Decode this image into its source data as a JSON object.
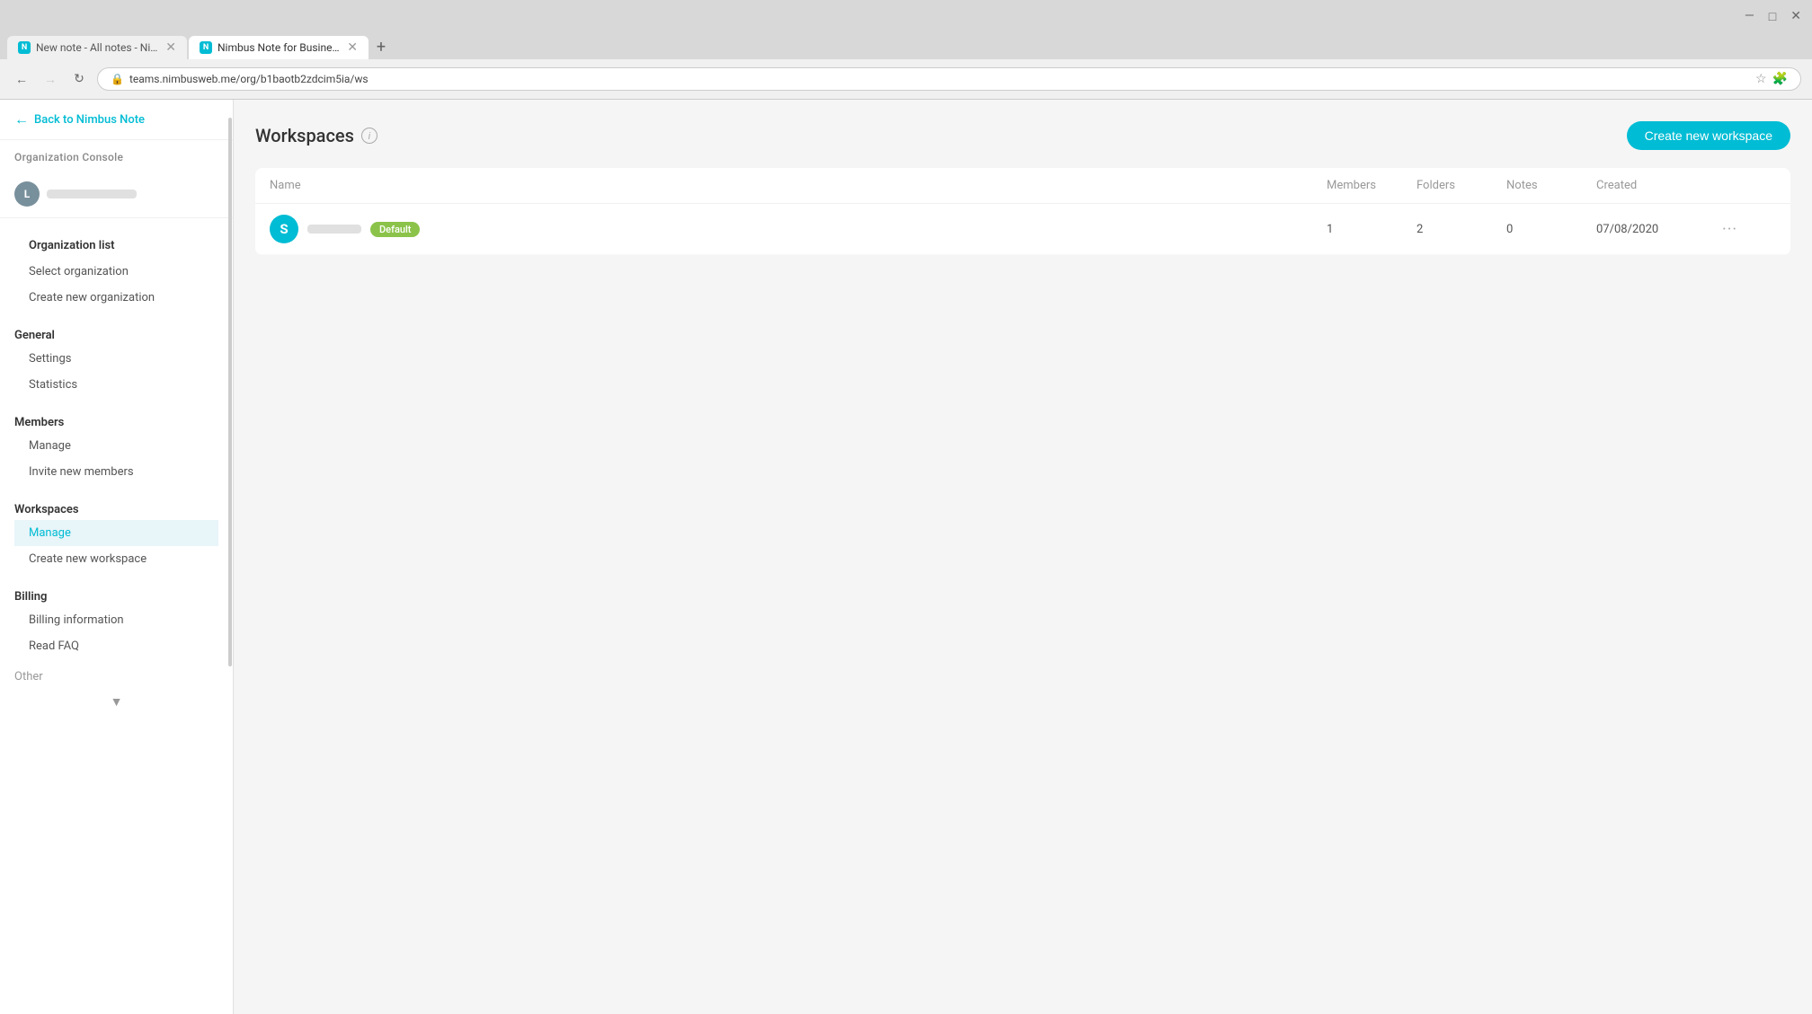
{
  "browser": {
    "tabs": [
      {
        "id": "tab1",
        "icon_letter": "N",
        "title": "New note - All notes - Nimbus ...",
        "active": false
      },
      {
        "id": "tab2",
        "icon_letter": "N",
        "title": "Nimbus Note for Business - Org...",
        "active": true
      }
    ],
    "new_tab_label": "+",
    "url": "teams.nimbusweb.me/org/b1baotb2zdcim5ia/ws",
    "nav": {
      "back_disabled": false,
      "forward_disabled": true
    }
  },
  "window_controls": {
    "minimize": "—",
    "maximize": "□",
    "close": "✕"
  },
  "sidebar": {
    "back_label": "Back to Nimbus Note",
    "org_console_label": "Organization Console",
    "user_avatar_letter": "L",
    "sections": [
      {
        "id": "org",
        "title": "",
        "items": [
          {
            "id": "org-list",
            "label": "Organization list",
            "is_section_title": true
          },
          {
            "id": "select-org",
            "label": "Select organization",
            "active": false
          },
          {
            "id": "create-org",
            "label": "Create new organization",
            "active": false
          }
        ]
      },
      {
        "id": "general",
        "title": "General",
        "items": [
          {
            "id": "settings",
            "label": "Settings",
            "active": false
          },
          {
            "id": "statistics",
            "label": "Statistics",
            "active": false
          }
        ]
      },
      {
        "id": "members",
        "title": "Members",
        "items": [
          {
            "id": "manage-members",
            "label": "Manage",
            "active": false
          },
          {
            "id": "invite-members",
            "label": "Invite new members",
            "active": false
          }
        ]
      },
      {
        "id": "workspaces",
        "title": "Workspaces",
        "items": [
          {
            "id": "manage-ws",
            "label": "Manage",
            "active": true
          },
          {
            "id": "create-ws",
            "label": "Create new workspace",
            "active": false
          }
        ]
      },
      {
        "id": "billing",
        "title": "Billing",
        "items": [
          {
            "id": "billing-info",
            "label": "Billing information",
            "active": false
          },
          {
            "id": "read-faq",
            "label": "Read FAQ",
            "active": false
          }
        ]
      }
    ]
  },
  "main": {
    "page_title": "Workspaces",
    "info_icon_label": "i",
    "create_button_label": "Create new workspace",
    "table": {
      "columns": [
        "Name",
        "Members",
        "Folders",
        "Notes",
        "Created",
        ""
      ],
      "rows": [
        {
          "avatar_letter": "S",
          "name_blurred": true,
          "badge": "Default",
          "members": "1",
          "folders": "2",
          "notes": "0",
          "created": "07/08/2020"
        }
      ]
    }
  }
}
